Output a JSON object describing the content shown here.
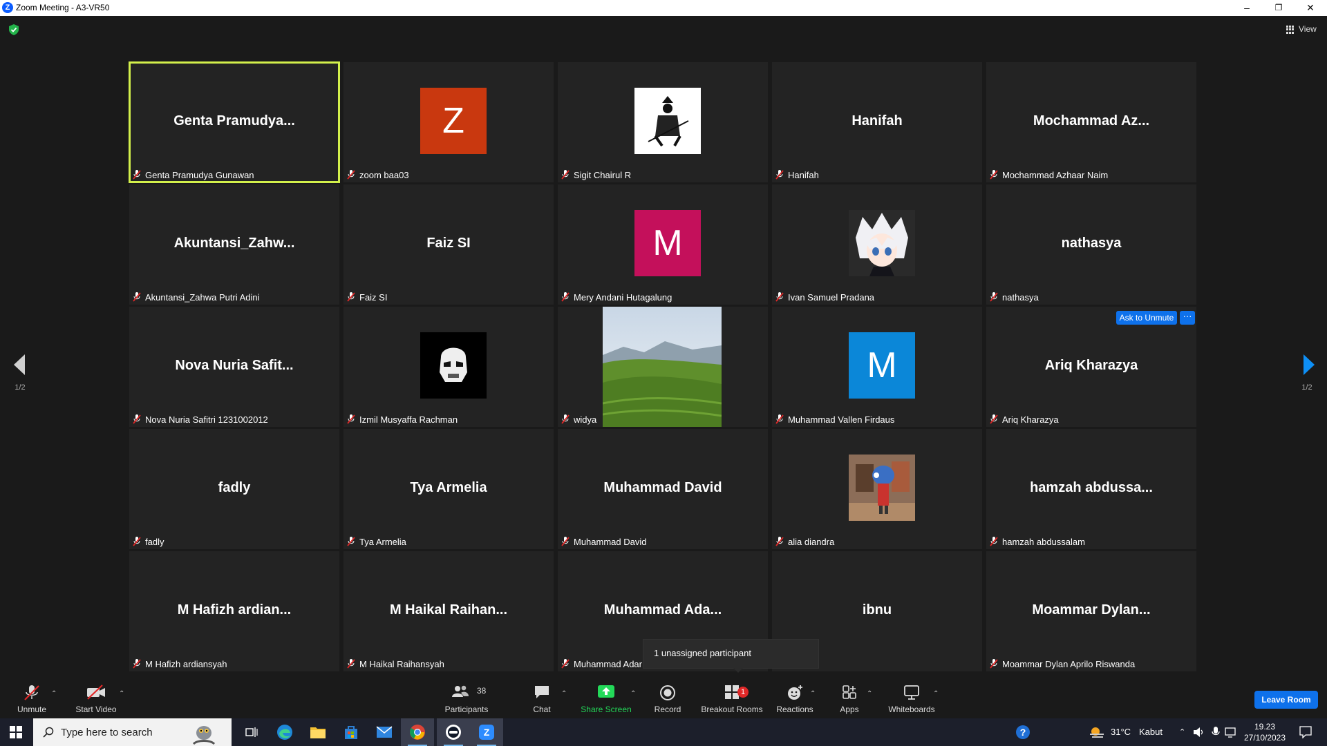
{
  "window": {
    "title": "Zoom Meeting - A3-VR50",
    "minimize": "–",
    "restore": "❐",
    "close": "✕"
  },
  "view_button": {
    "label": "View"
  },
  "pager": {
    "left_label": "1/2",
    "right_label": "1/2"
  },
  "tiles": [
    {
      "big": "Genta Pramudya...",
      "name": "Genta Pramudya Gunawan",
      "avatar": "none",
      "active": true
    },
    {
      "big": "",
      "name": "zoom baa03",
      "avatar": "letter",
      "letter": "Z",
      "color": "#c9380f"
    },
    {
      "big": "",
      "name": "Sigit Chairul R",
      "avatar": "samurai-image"
    },
    {
      "big": "Hanifah",
      "name": "Hanifah",
      "avatar": "none"
    },
    {
      "big": "Mochammad Az...",
      "name": "Mochammad Azhaar Naim",
      "avatar": "none"
    },
    {
      "big": "Akuntansi_Zahw...",
      "name": "Akuntansi_Zahwa Putri Adini",
      "avatar": "none"
    },
    {
      "big": "Faiz SI",
      "name": "Faiz SI",
      "avatar": "none"
    },
    {
      "big": "",
      "name": "Mery Andani Hutagalung",
      "avatar": "letter",
      "letter": "M",
      "color": "#c4105b"
    },
    {
      "big": "",
      "name": "Ivan Samuel Pradana",
      "avatar": "anime-image"
    },
    {
      "big": "nathasya",
      "name": "nathasya",
      "avatar": "none"
    },
    {
      "big": "Nova Nuria Safit...",
      "name": "Nova Nuria Safitri 1231002012",
      "avatar": "none"
    },
    {
      "big": "",
      "name": "Izmil Musyaffa Rachman",
      "avatar": "stormtrooper-image"
    },
    {
      "big": "",
      "name": "widya",
      "avatar": "landscape-photo"
    },
    {
      "big": "",
      "name": "Muhammad Vallen Firdaus",
      "avatar": "letter",
      "letter": "M",
      "color": "#0b87d8"
    },
    {
      "big": "Ariq Kharazya",
      "name": "Ariq Kharazya",
      "avatar": "none"
    },
    {
      "big": "fadly",
      "name": "fadly",
      "avatar": "none"
    },
    {
      "big": "Tya Armelia",
      "name": "Tya Armelia",
      "avatar": "none"
    },
    {
      "big": "Muhammad David",
      "name": "Muhammad David",
      "avatar": "none"
    },
    {
      "big": "",
      "name": "alia diandra",
      "avatar": "character-image"
    },
    {
      "big": "hamzah abdussa...",
      "name": "hamzah abdussalam",
      "avatar": "none"
    },
    {
      "big": "M Hafizh ardian...",
      "name": "M Hafizh ardiansyah",
      "avatar": "none"
    },
    {
      "big": "M Haikal Raihan...",
      "name": "M Haikal Raihansyah",
      "avatar": "none"
    },
    {
      "big": "Muhammad Ada...",
      "name": "Muhammad Adar",
      "avatar": "none"
    },
    {
      "big": "ibnu",
      "name": "",
      "avatar": "none"
    },
    {
      "big": "Moammar Dylan...",
      "name": "Moammar Dylan Aprilo Riswanda",
      "avatar": "none"
    }
  ],
  "tile_actions": {
    "ask_to_unmute": "Ask to Unmute",
    "more": "···"
  },
  "tooltip": {
    "text": "1 unassigned participant"
  },
  "toolbar": {
    "unmute": "Unmute",
    "start_video": "Start Video",
    "participants": "Participants",
    "participants_count": "38",
    "chat": "Chat",
    "share_screen": "Share Screen",
    "record": "Record",
    "breakout_rooms": "Breakout Rooms",
    "breakout_badge": "1",
    "reactions": "Reactions",
    "apps": "Apps",
    "whiteboards": "Whiteboards",
    "leave_room": "Leave Room"
  },
  "taskbar": {
    "search_placeholder": "Type here to search",
    "weather_temp": "31°C",
    "weather_desc": "Kabut",
    "time": "19.23",
    "date": "27/10/2023"
  },
  "colors": {
    "active_border": "#d3f04b",
    "accent_blue": "#0e71eb",
    "share_green": "#23d959",
    "muted_red": "#e02828"
  }
}
